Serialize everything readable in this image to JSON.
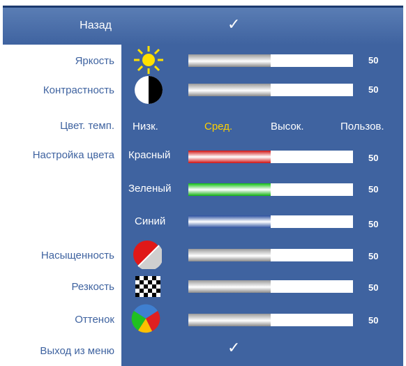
{
  "header": {
    "back_label": "Назад",
    "checkmark": "✓"
  },
  "brightness": {
    "label": "Яркость",
    "value": "50",
    "level": 0.5,
    "icon": "sun-icon"
  },
  "contrast": {
    "label": "Контрастность",
    "value": "50",
    "level": 0.5,
    "icon": "contrast-icon"
  },
  "color_temp": {
    "label": "Цвет. темп.",
    "options": [
      "Низк.",
      "Сред.",
      "Высок.",
      "Пользов."
    ],
    "selected": "Сред."
  },
  "color_setting": {
    "label": "Настройка цвета",
    "red": {
      "label": "Красный",
      "value": "50",
      "level": 0.5
    },
    "green": {
      "label": "Зеленый",
      "value": "50",
      "level": 0.5
    },
    "blue": {
      "label": "Синий",
      "value": "50",
      "level": 0.5
    }
  },
  "saturation": {
    "label": "Насыщенность",
    "value": "50",
    "level": 0.5,
    "icon": "saturation-icon"
  },
  "sharpness": {
    "label": "Резкость",
    "value": "50",
    "level": 0.5,
    "icon": "checkerboard-icon"
  },
  "hue": {
    "label": "Оттенок",
    "value": "50",
    "level": 0.5,
    "icon": "color-wheel-icon"
  },
  "footer": {
    "exit_label": "Выход из меню",
    "checkmark": "✓"
  },
  "colors": {
    "panel": "#3f63a0",
    "selected": "#ffd000",
    "label": "#3f63a0"
  }
}
